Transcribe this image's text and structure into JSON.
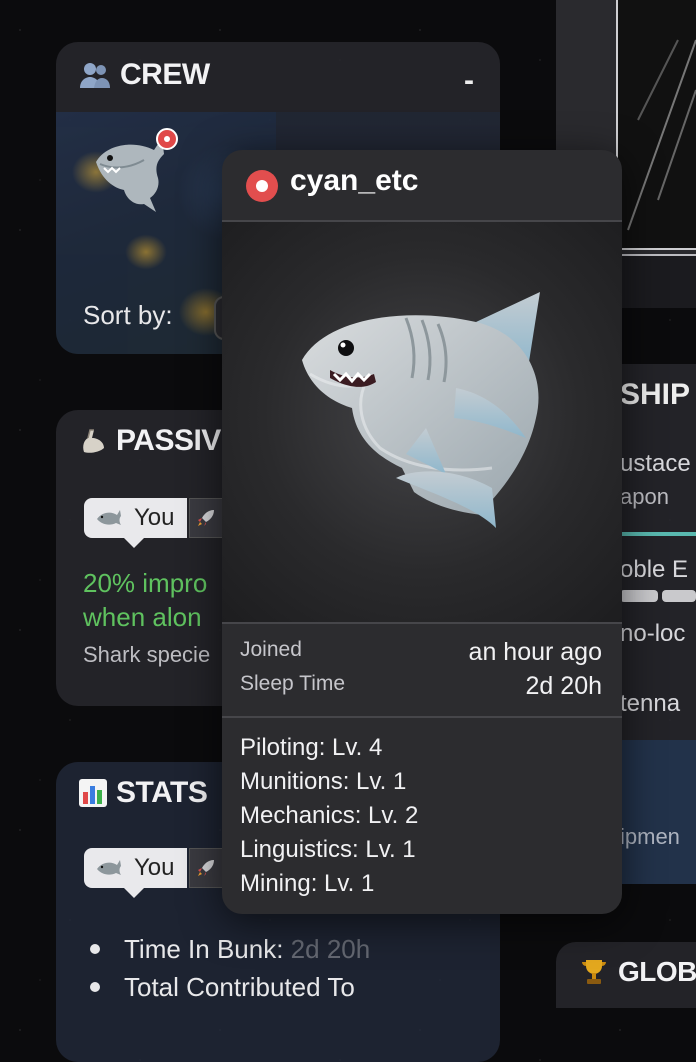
{
  "crew": {
    "title": "CREW",
    "minimize_label": "-",
    "sort_label": "Sort by:"
  },
  "passive": {
    "title": "PASSIV",
    "tab_you": "You",
    "description": "20% impro\nwhen alon",
    "subtext": "Shark specie"
  },
  "stats": {
    "title": "STATS",
    "tab_you": "You",
    "items": [
      {
        "label": "Time In Bunk:",
        "value": "2d 20h"
      },
      {
        "label": "Total Contributed To",
        "value": ""
      }
    ]
  },
  "ship": {
    "title": "SHIP",
    "lines": [
      "ustace",
      "apon",
      "oble E",
      "no-loc",
      "tenna",
      "ipmen"
    ]
  },
  "global": {
    "title": "GLOB"
  },
  "popup": {
    "name": "cyan_etc",
    "meta": [
      {
        "key": "Joined",
        "value": "an hour ago"
      },
      {
        "key": "Sleep Time",
        "value": "2d 20h"
      }
    ],
    "skills": [
      "Piloting: Lv. 4",
      "Munitions: Lv. 1",
      "Mechanics: Lv. 2",
      "Linguistics: Lv. 1",
      "Mining: Lv. 1"
    ]
  },
  "icons": {
    "crew": "people-icon",
    "passive": "flexed-biceps-icon",
    "stats": "bar-chart-icon",
    "global": "trophy-icon",
    "tab_species": "shark-icon",
    "tab_ship": "rocket-icon"
  },
  "colors": {
    "status_red": "#e24e4e",
    "passive_green": "#5fc25f",
    "popup_bg": "#2c2c2f"
  }
}
